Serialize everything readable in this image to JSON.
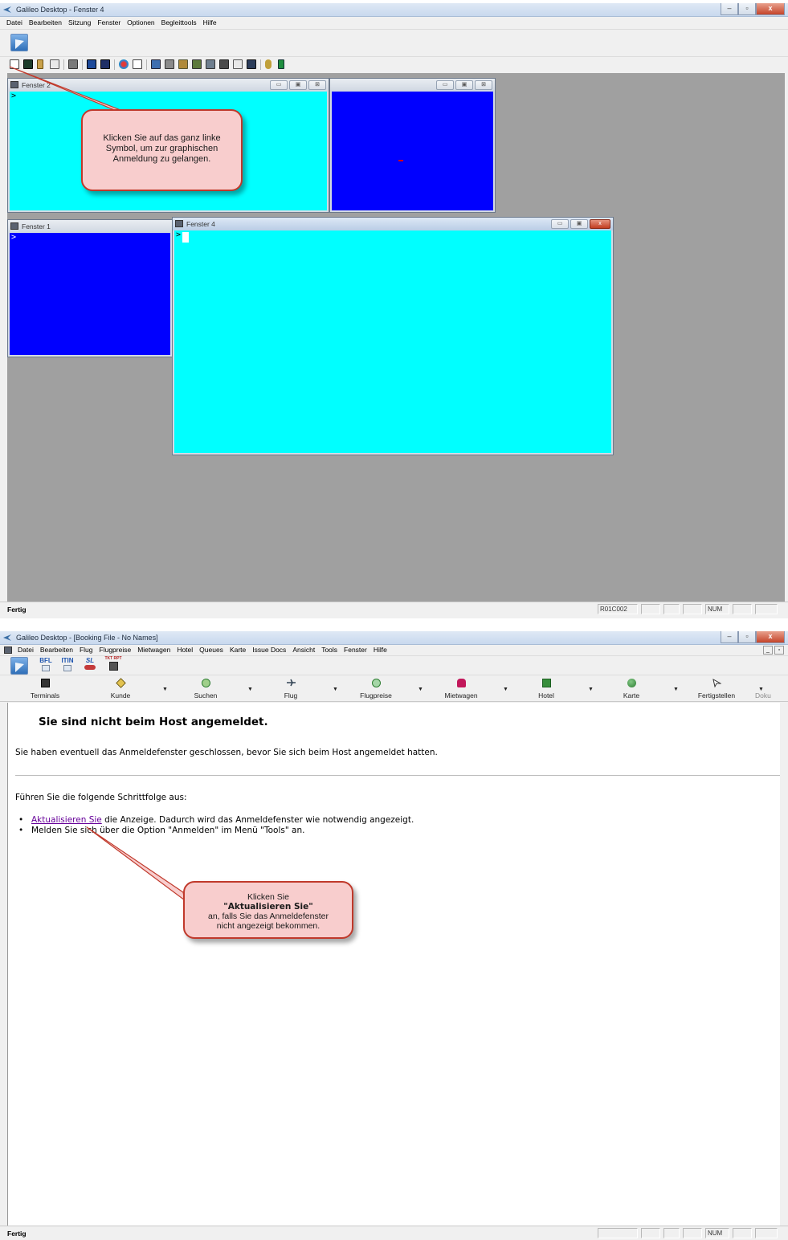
{
  "top": {
    "title": "Galileo Desktop - Fenster 4",
    "menu": [
      "Datei",
      "Bearbeiten",
      "Sitzung",
      "Fenster",
      "Optionen",
      "Begleittools",
      "Hilfe"
    ],
    "caption_buttons": {
      "minimize": "–",
      "maximize": "▫",
      "close": "x"
    },
    "windows": {
      "fenster2": {
        "title": "Fenster 2",
        "prompt": ">"
      },
      "unnamed": {
        "title": ""
      },
      "fenster1": {
        "title": "Fenster 1",
        "prompt": ">"
      },
      "fenster4": {
        "title": "Fenster 4",
        "prompt": ">"
      }
    },
    "window_buttons": {
      "min": "▭",
      "max": "▣",
      "close": "⊠",
      "close_active": "x"
    },
    "callout": "Klicken Sie auf das ganz linke Symbol, um zur graphischen Anmeldung zu gelangen.",
    "status": {
      "text": "Fertig",
      "cell1": "R01C002",
      "cell_num": "NUM"
    }
  },
  "bottom": {
    "title": "Galileo Desktop - [Booking File - No Names]",
    "menu": [
      "Datei",
      "Bearbeiten",
      "Flug",
      "Flugpreise",
      "Mietwagen",
      "Hotel",
      "Queues",
      "Karte",
      "Issue Docs",
      "Ansicht",
      "Tools",
      "Fenster",
      "Hilfe"
    ],
    "quick": {
      "bfl": "BFL",
      "itin": "ITIN",
      "sl": "SL",
      "tkt": "TKT RPT"
    },
    "nav": [
      {
        "label": "Terminals",
        "icon": "terminal-icon",
        "color": "#333333"
      },
      {
        "label": "Kunde",
        "icon": "tag-icon",
        "color": "#5a4a10"
      },
      {
        "label": "Suchen",
        "icon": "search-globe-icon",
        "color": "#2e7d32"
      },
      {
        "label": "Flug",
        "icon": "airplane-icon",
        "color": "#334455"
      },
      {
        "label": "Flugpreise",
        "icon": "fare-icon",
        "color": "#2e7d32"
      },
      {
        "label": "Mietwagen",
        "icon": "car-icon",
        "color": "#8e1a5a"
      },
      {
        "label": "Hotel",
        "icon": "hotel-icon",
        "color": "#1b5e20"
      },
      {
        "label": "Karte",
        "icon": "globe-icon",
        "color": "#2e7d32"
      },
      {
        "label": "Fertigstellen",
        "icon": "finish-icon",
        "color": "#333333"
      },
      {
        "label": "Doku",
        "icon": "doc-icon",
        "color": "#333333"
      }
    ],
    "drop_arrow": "▼",
    "content": {
      "heading": "Sie sind nicht beim Host angemeldet.",
      "para1": "Sie haben eventuell das Anmeldefenster geschlossen, bevor Sie sich beim Host angemeldet hatten.",
      "para2": "Führen Sie die folgende Schrittfolge aus:",
      "bullet1_link": "Aktualisieren Sie",
      "bullet1_rest": " die Anzeige. Dadurch wird das Anmeldefenster wie notwendig angezeigt.",
      "bullet2": "Melden Sie sich über die Option \"Anmelden\" im Menü \"Tools\" an."
    },
    "callout": {
      "line1": "Klicken Sie",
      "line2": "\"Aktualisieren Sie\"",
      "line3": "an, falls Sie das Anmeldefenster",
      "line4": "nicht angezeigt bekommen."
    },
    "status": {
      "text": "Fertig",
      "cell_num": "NUM"
    }
  },
  "colors": {
    "terminal_cyan": "#00ffff",
    "terminal_blue": "#0000ff",
    "callout_fill": "#f8cdcd",
    "callout_border": "#c0392b",
    "link": "#660099"
  }
}
